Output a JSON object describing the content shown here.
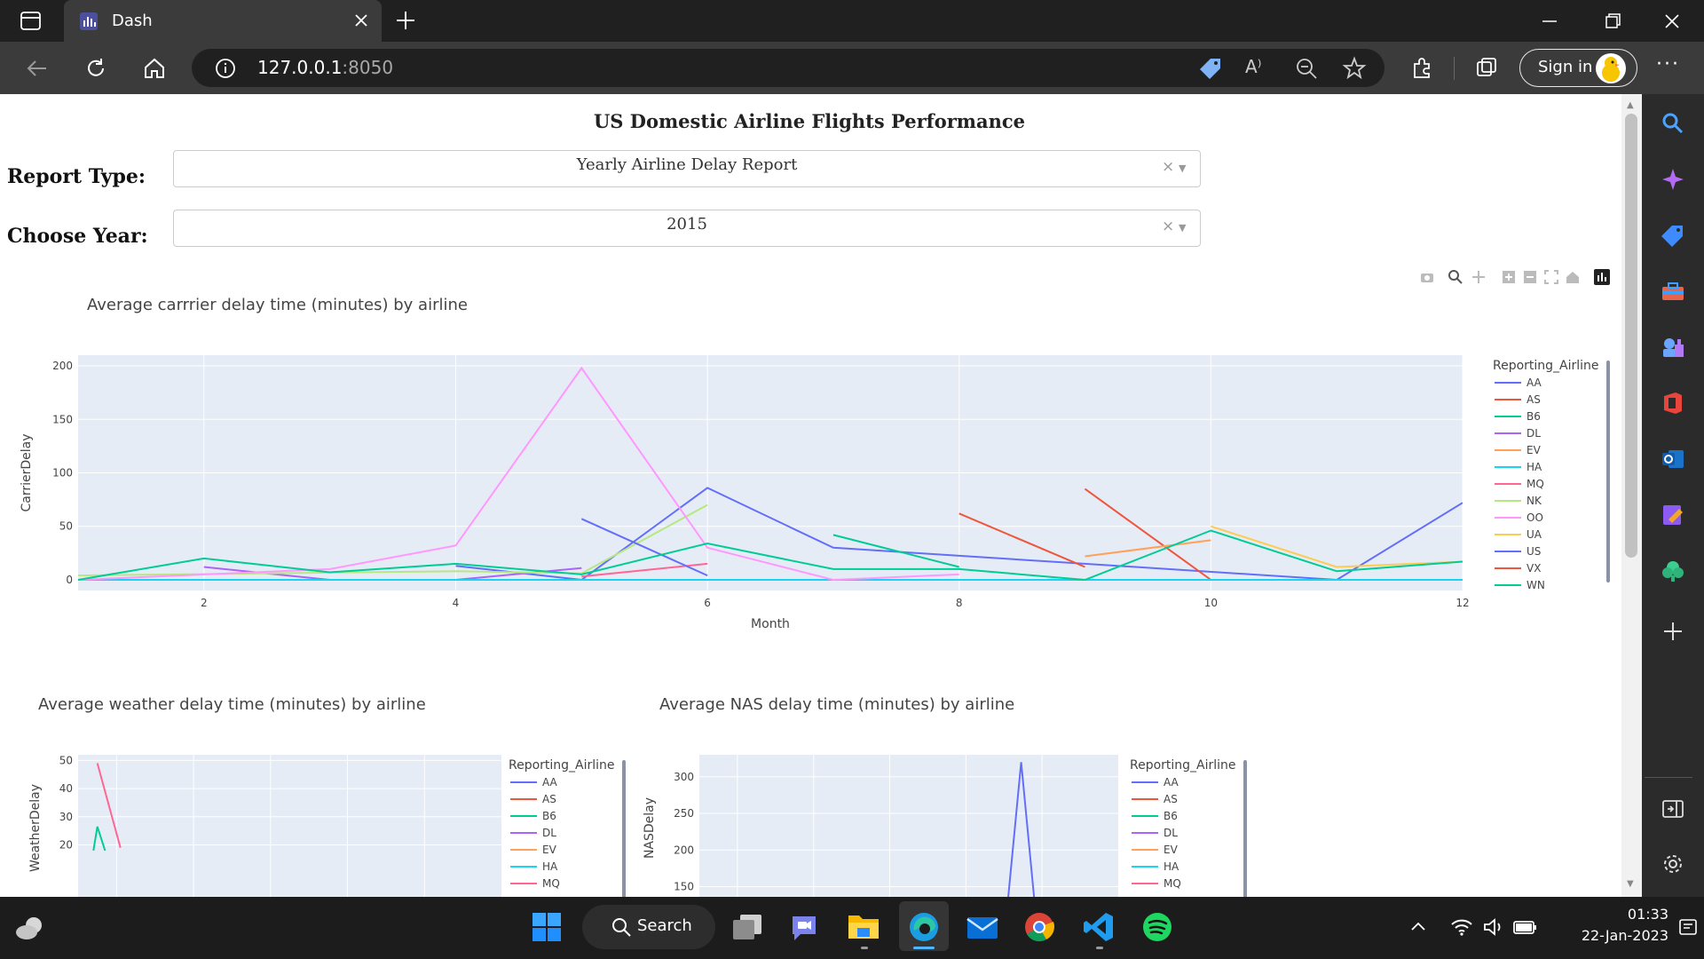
{
  "browser": {
    "tab_title": "Dash",
    "url_host": "127.0.0.1",
    "url_port": ":8050",
    "signin_label": "Sign in"
  },
  "page": {
    "title": "US Domestic Airline Flights Performance",
    "report_type": {
      "label": "Report Type:",
      "value": "Yearly Airline Delay Report",
      "clear": "×"
    },
    "choose_year": {
      "label": "Choose Year:",
      "value": "2015",
      "clear": "×"
    }
  },
  "taskbar": {
    "search_label": "Search",
    "time": "01:33",
    "date": "22-Jan-2023"
  },
  "colors": {
    "AA": "#636efa",
    "AS": "#EF553B",
    "B6": "#00cc96",
    "DL": "#ab63fa",
    "EV": "#FFA15A",
    "HA": "#19d3f3",
    "MQ": "#FF6692",
    "NK": "#B6E880",
    "OO": "#FF97FF",
    "UA": "#FECB52",
    "US": "#636efa",
    "VX": "#EF553B",
    "WN": "#00cc96"
  },
  "chart_data": [
    {
      "type": "line",
      "title": "Average carrrier delay time (minutes) by airline",
      "xlabel": "Month",
      "ylabel": "CarrierDelay",
      "xlim": [
        1,
        12
      ],
      "ylim": [
        -10,
        210
      ],
      "x_ticks": [
        2,
        4,
        6,
        8,
        10,
        12
      ],
      "y_ticks": [
        0,
        50,
        100,
        150,
        200
      ],
      "legend_title": "Reporting_Airline",
      "series": [
        {
          "name": "AA",
          "points": [
            [
              4,
              13
            ],
            [
              5,
              0
            ],
            [
              6,
              86
            ],
            [
              7,
              30
            ],
            [
              11,
              0
            ],
            [
              12,
              72
            ]
          ]
        },
        {
          "name": "AS",
          "points": [
            [
              9,
              85
            ],
            [
              10,
              0
            ]
          ]
        },
        {
          "name": "B6",
          "points": [
            [
              7,
              42
            ],
            [
              8,
              12
            ]
          ]
        },
        {
          "name": "DL",
          "points": [
            [
              2,
              12
            ],
            [
              3,
              0
            ],
            [
              4,
              0
            ],
            [
              5,
              11
            ]
          ]
        },
        {
          "name": "EV",
          "points": [
            [
              9,
              22
            ],
            [
              10,
              37
            ]
          ]
        },
        {
          "name": "HA",
          "points": [
            [
              1,
              0
            ],
            [
              12,
              0
            ]
          ]
        },
        {
          "name": "MQ",
          "points": [
            [
              5,
              3
            ],
            [
              6,
              15
            ]
          ]
        },
        {
          "name": "NK",
          "points": [
            [
              1,
              4
            ],
            [
              4,
              8
            ],
            [
              5,
              6
            ],
            [
              6,
              70
            ]
          ]
        },
        {
          "name": "OO",
          "points": [
            [
              1,
              0
            ],
            [
              3,
              10
            ],
            [
              4,
              32
            ],
            [
              5,
              198
            ],
            [
              6,
              30
            ],
            [
              7,
              0
            ],
            [
              8,
              5
            ]
          ]
        },
        {
          "name": "UA",
          "points": [
            [
              10,
              50
            ],
            [
              11,
              12
            ],
            [
              12,
              17
            ]
          ]
        },
        {
          "name": "US",
          "points": [
            [
              5,
              57
            ],
            [
              6,
              4
            ]
          ]
        },
        {
          "name": "VX",
          "points": [
            [
              8,
              62
            ],
            [
              9,
              12
            ]
          ]
        },
        {
          "name": "WN",
          "points": [
            [
              1,
              0
            ],
            [
              2,
              20
            ],
            [
              3,
              7
            ],
            [
              4,
              15
            ],
            [
              5,
              5
            ],
            [
              6,
              34
            ],
            [
              7,
              10
            ],
            [
              8,
              10
            ],
            [
              9,
              0
            ],
            [
              10,
              46
            ],
            [
              11,
              8
            ],
            [
              12,
              17
            ]
          ]
        }
      ]
    },
    {
      "type": "line",
      "title": "Average weather delay time (minutes) by airline",
      "ylabel": "WeatherDelay",
      "xlim": [
        1,
        12
      ],
      "ylim": [
        0,
        52
      ],
      "y_ticks": [
        20,
        30,
        40,
        50
      ],
      "legend_title": "Reporting_Airline",
      "legend_items": [
        "AA",
        "AS",
        "B6",
        "DL",
        "EV",
        "HA",
        "MQ"
      ],
      "series": [
        {
          "name": "MQ",
          "points": [
            [
              1.5,
              49
            ],
            [
              2.1,
              19
            ]
          ]
        },
        {
          "name": "B6",
          "points": [
            [
              1.4,
              18
            ],
            [
              1.5,
              26.5
            ],
            [
              1.7,
              18
            ]
          ]
        }
      ]
    },
    {
      "type": "line",
      "title": "Average NAS delay time (minutes) by airline",
      "ylabel": "NASDelay",
      "xlim": [
        1,
        12
      ],
      "ylim": [
        130,
        330
      ],
      "y_ticks": [
        150,
        200,
        250,
        300
      ],
      "legend_title": "Reporting_Airline",
      "legend_items": [
        "AA",
        "AS",
        "B6",
        "DL",
        "EV",
        "HA",
        "MQ"
      ],
      "series": [
        {
          "name": "AA",
          "points": [
            [
              9.1,
              130
            ],
            [
              9.45,
              320
            ],
            [
              9.8,
              130
            ]
          ]
        }
      ]
    }
  ]
}
